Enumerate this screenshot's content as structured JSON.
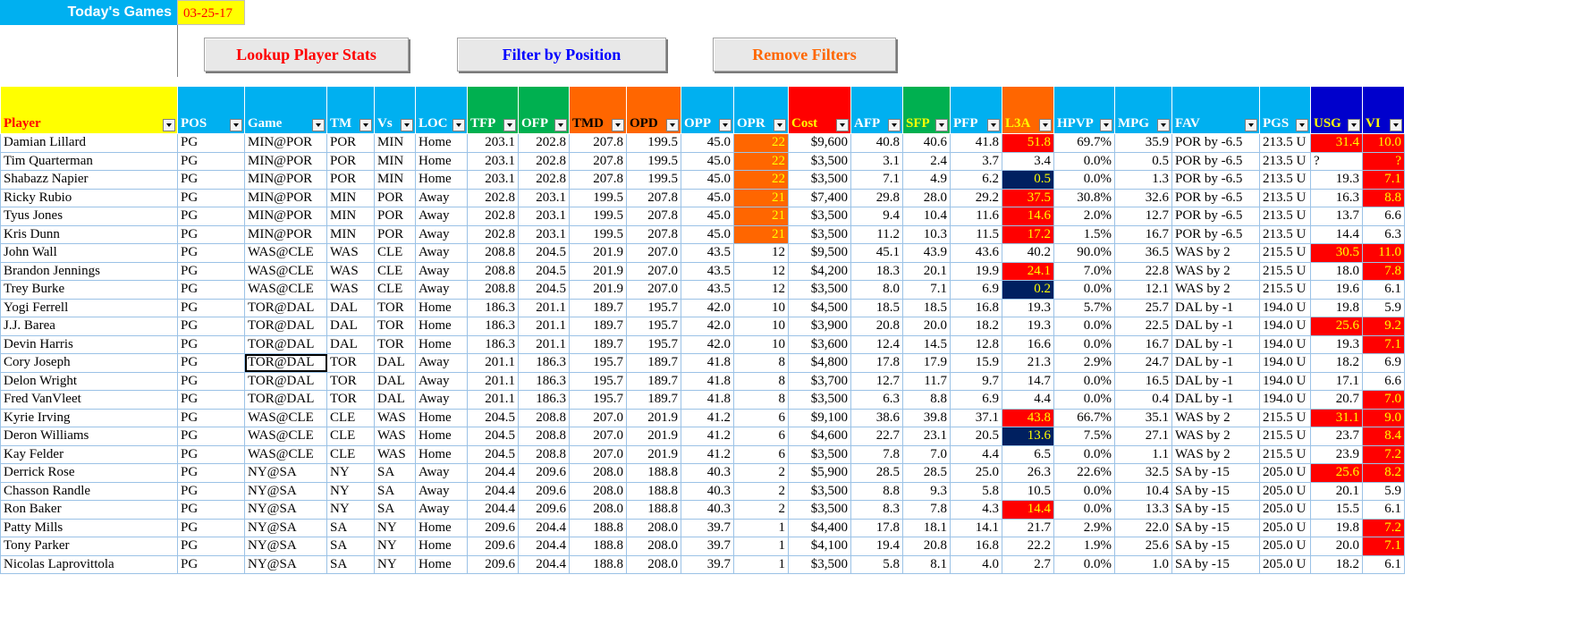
{
  "header": {
    "label": "Today's Games",
    "date": "03-25-17"
  },
  "buttons": [
    {
      "label": "Lookup Player Stats",
      "color": "#ff0000"
    },
    {
      "label": "Filter by Position",
      "color": "#0000ff"
    },
    {
      "label": "Remove Filters",
      "color": "#ff6600"
    }
  ],
  "columns": [
    {
      "key": "player",
      "label": "Player",
      "bg": "#ffff00",
      "fg": "#ff0000",
      "align": "left"
    },
    {
      "key": "pos",
      "label": "POS",
      "bg": "#00b0f0",
      "fg": "#ffffff",
      "align": "left"
    },
    {
      "key": "game",
      "label": "Game",
      "bg": "#00b0f0",
      "fg": "#ffffff",
      "align": "left"
    },
    {
      "key": "tm",
      "label": "TM",
      "bg": "#00b0f0",
      "fg": "#ffffff",
      "align": "left"
    },
    {
      "key": "vs",
      "label": "Vs",
      "bg": "#00b0f0",
      "fg": "#ffffff",
      "align": "left"
    },
    {
      "key": "loc",
      "label": "LOC",
      "bg": "#00b0f0",
      "fg": "#ffffff",
      "align": "left"
    },
    {
      "key": "tfp",
      "label": "TFP",
      "bg": "#00b050",
      "fg": "#ffffff",
      "align": "right"
    },
    {
      "key": "ofp",
      "label": "OFP",
      "bg": "#00b050",
      "fg": "#ffffff",
      "align": "right"
    },
    {
      "key": "tmd",
      "label": "TMD",
      "bg": "#ff6600",
      "fg": "#000000",
      "align": "right"
    },
    {
      "key": "opd",
      "label": "OPD",
      "bg": "#ff6600",
      "fg": "#000000",
      "align": "right"
    },
    {
      "key": "opp",
      "label": "OPP",
      "bg": "#00b0f0",
      "fg": "#ffffff",
      "align": "right"
    },
    {
      "key": "opr",
      "label": "OPR",
      "bg": "#00b0f0",
      "fg": "#ffffff",
      "align": "right"
    },
    {
      "key": "cost",
      "label": "Cost",
      "bg": "#ff0000",
      "fg": "#ffff00",
      "align": "right"
    },
    {
      "key": "afp",
      "label": "AFP",
      "bg": "#00b0f0",
      "fg": "#ffffff",
      "align": "right"
    },
    {
      "key": "sfp",
      "label": "SFP",
      "bg": "#00b050",
      "fg": "#ffff00",
      "align": "right"
    },
    {
      "key": "pfp",
      "label": "PFP",
      "bg": "#00b0f0",
      "fg": "#ffffff",
      "align": "right"
    },
    {
      "key": "l3a",
      "label": "L3A",
      "bg": "#ff6600",
      "fg": "#ffff00",
      "align": "right"
    },
    {
      "key": "hpvp",
      "label": "HPVP",
      "bg": "#00b0f0",
      "fg": "#ffffff",
      "align": "right"
    },
    {
      "key": "mpg",
      "label": "MPG",
      "bg": "#00b0f0",
      "fg": "#ffffff",
      "align": "right"
    },
    {
      "key": "fav",
      "label": "FAV",
      "bg": "#00b0f0",
      "fg": "#ffffff",
      "align": "left"
    },
    {
      "key": "pgs",
      "label": "PGS",
      "bg": "#00b0f0",
      "fg": "#ffffff",
      "align": "left"
    },
    {
      "key": "usg",
      "label": "USG",
      "bg": "#0000cc",
      "fg": "#ffff00",
      "align": "right"
    },
    {
      "key": "vi",
      "label": "VI",
      "bg": "#0000cc",
      "fg": "#ffff00",
      "align": "right"
    }
  ],
  "colors": {
    "opr_hot": "#ff6600",
    "red": "#ff0000",
    "navy": "#002060",
    "yellow_text": "#ffff00"
  },
  "rows": [
    [
      "Damian Lillard",
      "PG",
      "MIN@POR",
      "POR",
      "MIN",
      "Home",
      "203.1",
      "202.8",
      "207.8",
      "199.5",
      "45.0",
      "22",
      "$9,600",
      "40.8",
      "40.6",
      "41.8",
      "51.8",
      "69.7%",
      "35.9",
      "POR by -6.5",
      "213.5 U",
      "31.4",
      "10.0"
    ],
    [
      "Tim Quarterman",
      "PG",
      "MIN@POR",
      "POR",
      "MIN",
      "Home",
      "203.1",
      "202.8",
      "207.8",
      "199.5",
      "45.0",
      "22",
      "$3,500",
      "3.1",
      "2.4",
      "3.7",
      "3.4",
      "0.0%",
      "0.5",
      "POR by -6.5",
      "213.5 U",
      "?",
      "?"
    ],
    [
      "Shabazz Napier",
      "PG",
      "MIN@POR",
      "POR",
      "MIN",
      "Home",
      "203.1",
      "202.8",
      "207.8",
      "199.5",
      "45.0",
      "22",
      "$3,500",
      "7.1",
      "4.9",
      "6.2",
      "0.5",
      "0.0%",
      "1.3",
      "POR by -6.5",
      "213.5 U",
      "19.3",
      "7.1"
    ],
    [
      "Ricky Rubio",
      "PG",
      "MIN@POR",
      "MIN",
      "POR",
      "Away",
      "202.8",
      "203.1",
      "199.5",
      "207.8",
      "45.0",
      "21",
      "$7,400",
      "29.8",
      "28.0",
      "29.2",
      "37.5",
      "30.8%",
      "32.6",
      "POR by -6.5",
      "213.5 U",
      "16.3",
      "8.8"
    ],
    [
      "Tyus Jones",
      "PG",
      "MIN@POR",
      "MIN",
      "POR",
      "Away",
      "202.8",
      "203.1",
      "199.5",
      "207.8",
      "45.0",
      "21",
      "$3,500",
      "9.4",
      "10.4",
      "11.6",
      "14.6",
      "2.0%",
      "12.7",
      "POR by -6.5",
      "213.5 U",
      "13.7",
      "6.6"
    ],
    [
      "Kris Dunn",
      "PG",
      "MIN@POR",
      "MIN",
      "POR",
      "Away",
      "202.8",
      "203.1",
      "199.5",
      "207.8",
      "45.0",
      "21",
      "$3,500",
      "11.2",
      "10.3",
      "11.5",
      "17.2",
      "1.5%",
      "16.7",
      "POR by -6.5",
      "213.5 U",
      "14.4",
      "6.3"
    ],
    [
      "John Wall",
      "PG",
      "WAS@CLE",
      "WAS",
      "CLE",
      "Away",
      "208.8",
      "204.5",
      "201.9",
      "207.0",
      "43.5",
      "12",
      "$9,500",
      "45.1",
      "43.9",
      "43.6",
      "40.2",
      "90.0%",
      "36.5",
      "WAS by 2",
      "215.5 U",
      "30.5",
      "11.0"
    ],
    [
      "Brandon Jennings",
      "PG",
      "WAS@CLE",
      "WAS",
      "CLE",
      "Away",
      "208.8",
      "204.5",
      "201.9",
      "207.0",
      "43.5",
      "12",
      "$4,200",
      "18.3",
      "20.1",
      "19.9",
      "24.1",
      "7.0%",
      "22.8",
      "WAS by 2",
      "215.5 U",
      "18.0",
      "7.8"
    ],
    [
      "Trey Burke",
      "PG",
      "WAS@CLE",
      "WAS",
      "CLE",
      "Away",
      "208.8",
      "204.5",
      "201.9",
      "207.0",
      "43.5",
      "12",
      "$3,500",
      "8.0",
      "7.1",
      "6.9",
      "0.2",
      "0.0%",
      "12.1",
      "WAS by 2",
      "215.5 U",
      "19.6",
      "6.1"
    ],
    [
      "Yogi Ferrell",
      "PG",
      "TOR@DAL",
      "DAL",
      "TOR",
      "Home",
      "186.3",
      "201.1",
      "189.7",
      "195.7",
      "42.0",
      "10",
      "$4,500",
      "18.5",
      "18.5",
      "16.8",
      "19.3",
      "5.7%",
      "25.7",
      "DAL by -1",
      "194.0 U",
      "19.8",
      "5.9"
    ],
    [
      "J.J. Barea",
      "PG",
      "TOR@DAL",
      "DAL",
      "TOR",
      "Home",
      "186.3",
      "201.1",
      "189.7",
      "195.7",
      "42.0",
      "10",
      "$3,900",
      "20.8",
      "20.0",
      "18.2",
      "19.3",
      "0.0%",
      "22.5",
      "DAL by -1",
      "194.0 U",
      "25.6",
      "9.2"
    ],
    [
      "Devin Harris",
      "PG",
      "TOR@DAL",
      "DAL",
      "TOR",
      "Home",
      "186.3",
      "201.1",
      "189.7",
      "195.7",
      "42.0",
      "10",
      "$3,600",
      "12.4",
      "14.5",
      "12.8",
      "16.6",
      "0.0%",
      "16.7",
      "DAL by -1",
      "194.0 U",
      "19.3",
      "7.1"
    ],
    [
      "Cory Joseph",
      "PG",
      "TOR@DAL",
      "TOR",
      "DAL",
      "Away",
      "201.1",
      "186.3",
      "195.7",
      "189.7",
      "41.8",
      "8",
      "$4,800",
      "17.8",
      "17.9",
      "15.9",
      "21.3",
      "2.9%",
      "24.7",
      "DAL by -1",
      "194.0 U",
      "18.2",
      "6.9"
    ],
    [
      "Delon Wright",
      "PG",
      "TOR@DAL",
      "TOR",
      "DAL",
      "Away",
      "201.1",
      "186.3",
      "195.7",
      "189.7",
      "41.8",
      "8",
      "$3,700",
      "12.7",
      "11.7",
      "9.7",
      "14.7",
      "0.0%",
      "16.5",
      "DAL by -1",
      "194.0 U",
      "17.1",
      "6.6"
    ],
    [
      "Fred VanVleet",
      "PG",
      "TOR@DAL",
      "TOR",
      "DAL",
      "Away",
      "201.1",
      "186.3",
      "195.7",
      "189.7",
      "41.8",
      "8",
      "$3,500",
      "6.3",
      "8.8",
      "6.9",
      "4.4",
      "0.0%",
      "0.4",
      "DAL by -1",
      "194.0 U",
      "20.7",
      "7.0"
    ],
    [
      "Kyrie Irving",
      "PG",
      "WAS@CLE",
      "CLE",
      "WAS",
      "Home",
      "204.5",
      "208.8",
      "207.0",
      "201.9",
      "41.2",
      "6",
      "$9,100",
      "38.6",
      "39.8",
      "37.1",
      "43.8",
      "66.7%",
      "35.1",
      "WAS by 2",
      "215.5 U",
      "31.1",
      "9.0"
    ],
    [
      "Deron Williams",
      "PG",
      "WAS@CLE",
      "CLE",
      "WAS",
      "Home",
      "204.5",
      "208.8",
      "207.0",
      "201.9",
      "41.2",
      "6",
      "$4,600",
      "22.7",
      "23.1",
      "20.5",
      "13.6",
      "7.5%",
      "27.1",
      "WAS by 2",
      "215.5 U",
      "23.7",
      "8.4"
    ],
    [
      "Kay Felder",
      "PG",
      "WAS@CLE",
      "CLE",
      "WAS",
      "Home",
      "204.5",
      "208.8",
      "207.0",
      "201.9",
      "41.2",
      "6",
      "$3,500",
      "7.8",
      "7.0",
      "4.4",
      "6.5",
      "0.0%",
      "1.1",
      "WAS by 2",
      "215.5 U",
      "23.9",
      "7.2"
    ],
    [
      "Derrick Rose",
      "PG",
      "NY@SA",
      "NY",
      "SA",
      "Away",
      "204.4",
      "209.6",
      "208.0",
      "188.8",
      "40.3",
      "2",
      "$5,900",
      "28.5",
      "28.5",
      "25.0",
      "26.3",
      "22.6%",
      "32.5",
      "SA by -15",
      "205.0 U",
      "25.6",
      "8.2"
    ],
    [
      "Chasson Randle",
      "PG",
      "NY@SA",
      "NY",
      "SA",
      "Away",
      "204.4",
      "209.6",
      "208.0",
      "188.8",
      "40.3",
      "2",
      "$3,500",
      "8.8",
      "9.3",
      "5.8",
      "10.5",
      "0.0%",
      "10.4",
      "SA by -15",
      "205.0 U",
      "20.1",
      "5.9"
    ],
    [
      "Ron Baker",
      "PG",
      "NY@SA",
      "NY",
      "SA",
      "Away",
      "204.4",
      "209.6",
      "208.0",
      "188.8",
      "40.3",
      "2",
      "$3,500",
      "8.3",
      "7.8",
      "4.3",
      "14.4",
      "0.0%",
      "13.3",
      "SA by -15",
      "205.0 U",
      "15.5",
      "6.1"
    ],
    [
      "Patty Mills",
      "PG",
      "NY@SA",
      "SA",
      "NY",
      "Home",
      "209.6",
      "204.4",
      "188.8",
      "208.0",
      "39.7",
      "1",
      "$4,400",
      "17.8",
      "18.1",
      "14.1",
      "21.7",
      "2.9%",
      "22.0",
      "SA by -15",
      "205.0 U",
      "19.8",
      "7.2"
    ],
    [
      "Tony Parker",
      "PG",
      "NY@SA",
      "SA",
      "NY",
      "Home",
      "209.6",
      "204.4",
      "188.8",
      "208.0",
      "39.7",
      "1",
      "$4,100",
      "19.4",
      "20.8",
      "16.8",
      "22.2",
      "1.9%",
      "25.6",
      "SA by -15",
      "205.0 U",
      "20.0",
      "7.1"
    ],
    [
      "Nicolas Laprovittola",
      "PG",
      "NY@SA",
      "SA",
      "NY",
      "Home",
      "209.6",
      "204.4",
      "188.8",
      "208.0",
      "39.7",
      "1",
      "$3,500",
      "5.8",
      "8.1",
      "4.0",
      "2.7",
      "0.0%",
      "1.0",
      "SA by -15",
      "205.0 U",
      "18.2",
      "6.1"
    ]
  ],
  "highlights": {
    "opr_hot_rows": [
      0,
      1,
      2,
      3,
      4,
      5
    ],
    "l3a_red_rows": [
      0,
      3,
      4,
      5,
      7,
      15,
      20
    ],
    "l3a_navy_rows": [
      2,
      8,
      16
    ],
    "usg_red_rows": [
      0,
      6,
      10,
      15,
      18
    ],
    "vi_red_rows": [
      0,
      1,
      2,
      3,
      6,
      7,
      10,
      11,
      14,
      15,
      16,
      17,
      18,
      21,
      22
    ]
  }
}
